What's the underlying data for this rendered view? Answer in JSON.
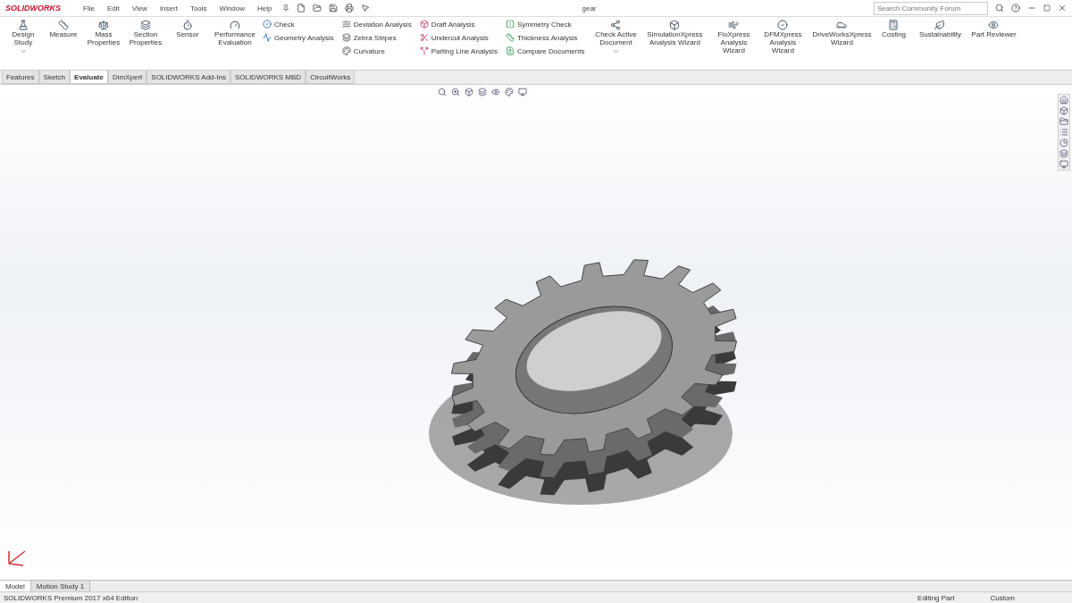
{
  "title_bar": {
    "logo": "SOLIDWORKS",
    "menu": [
      "File",
      "Edit",
      "View",
      "Insert",
      "Tools",
      "Window",
      "Help"
    ],
    "document_title": "gear",
    "search": {
      "placeholder": "Search Community Forum"
    }
  },
  "ribbon": {
    "large_left": [
      {
        "label": "Design Study",
        "dropdown": true
      },
      {
        "label": "Measure",
        "dropdown": false
      },
      {
        "label": "Mass Properties",
        "dropdown": false
      },
      {
        "label": "Section Properties",
        "dropdown": false
      },
      {
        "label": "Sensor",
        "dropdown": false
      },
      {
        "label": "Performance Evaluation",
        "dropdown": false
      }
    ],
    "small_columns": [
      [
        "Check",
        "Geometry Analysis"
      ],
      [
        "Deviation Analysis",
        "Zebra Stripes",
        "Curvature"
      ],
      [
        "Draft Analysis",
        "Undercut Analysis",
        "Parting Line Analysis"
      ],
      [
        "Symmetry Check",
        "Thickness Analysis",
        "Compare Documents"
      ]
    ],
    "large_right": [
      {
        "label": "Check Active Document",
        "dropdown": true
      },
      {
        "label": "SimulationXpress Analysis Wizard",
        "dropdown": false
      },
      {
        "label": "FloXpress Analysis Wizard",
        "dropdown": false
      },
      {
        "label": "DFMXpress Analysis Wizard",
        "dropdown": false
      },
      {
        "label": "DriveWorksXpress Wizard",
        "dropdown": false
      },
      {
        "label": "Costing",
        "dropdown": false
      },
      {
        "label": "Sustainability",
        "dropdown": false
      },
      {
        "label": "Part Reviewer",
        "dropdown": false
      }
    ]
  },
  "tabs": [
    {
      "label": "Features",
      "selected": false
    },
    {
      "label": "Sketch",
      "selected": false
    },
    {
      "label": "Evaluate",
      "selected": true
    },
    {
      "label": "DimXpert",
      "selected": false
    },
    {
      "label": "SOLIDWORKS Add-Ins",
      "selected": false
    },
    {
      "label": "SOLIDWORKS MBD",
      "selected": false
    },
    {
      "label": "CircuitWorks",
      "selected": false
    }
  ],
  "bottom_tabs": [
    {
      "label": "Model",
      "selected": true
    },
    {
      "label": "Motion Study 1",
      "selected": false
    }
  ],
  "status_bar": {
    "edition": "SOLIDWORKS Premium 2017 x64 Edition",
    "mode": "Editing Part",
    "units": "Custom"
  }
}
